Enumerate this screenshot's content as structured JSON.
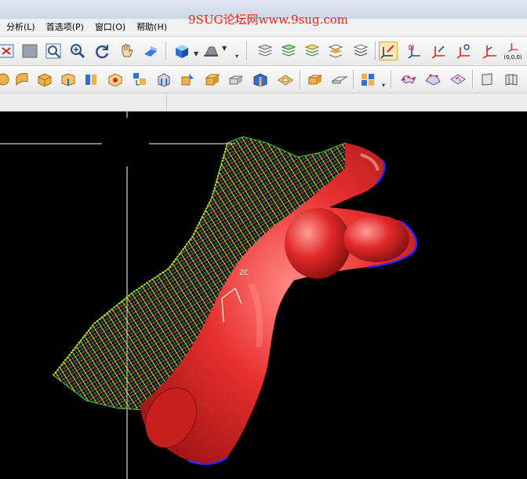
{
  "watermark": "9SUG论坛网www.9sug.com",
  "menu": {
    "items": [
      {
        "label": "分析(L)"
      },
      {
        "label": "首选项(P)"
      },
      {
        "label": "窗口(O)"
      },
      {
        "label": "帮助(H)"
      }
    ]
  },
  "toolbar": {
    "origin_label": "(0,0,0)",
    "active_tool": "wcs-dynamic-icon"
  },
  "viewport": {
    "background": "#000000",
    "model_color": "#e8302f",
    "wcs_label": "ZC"
  }
}
